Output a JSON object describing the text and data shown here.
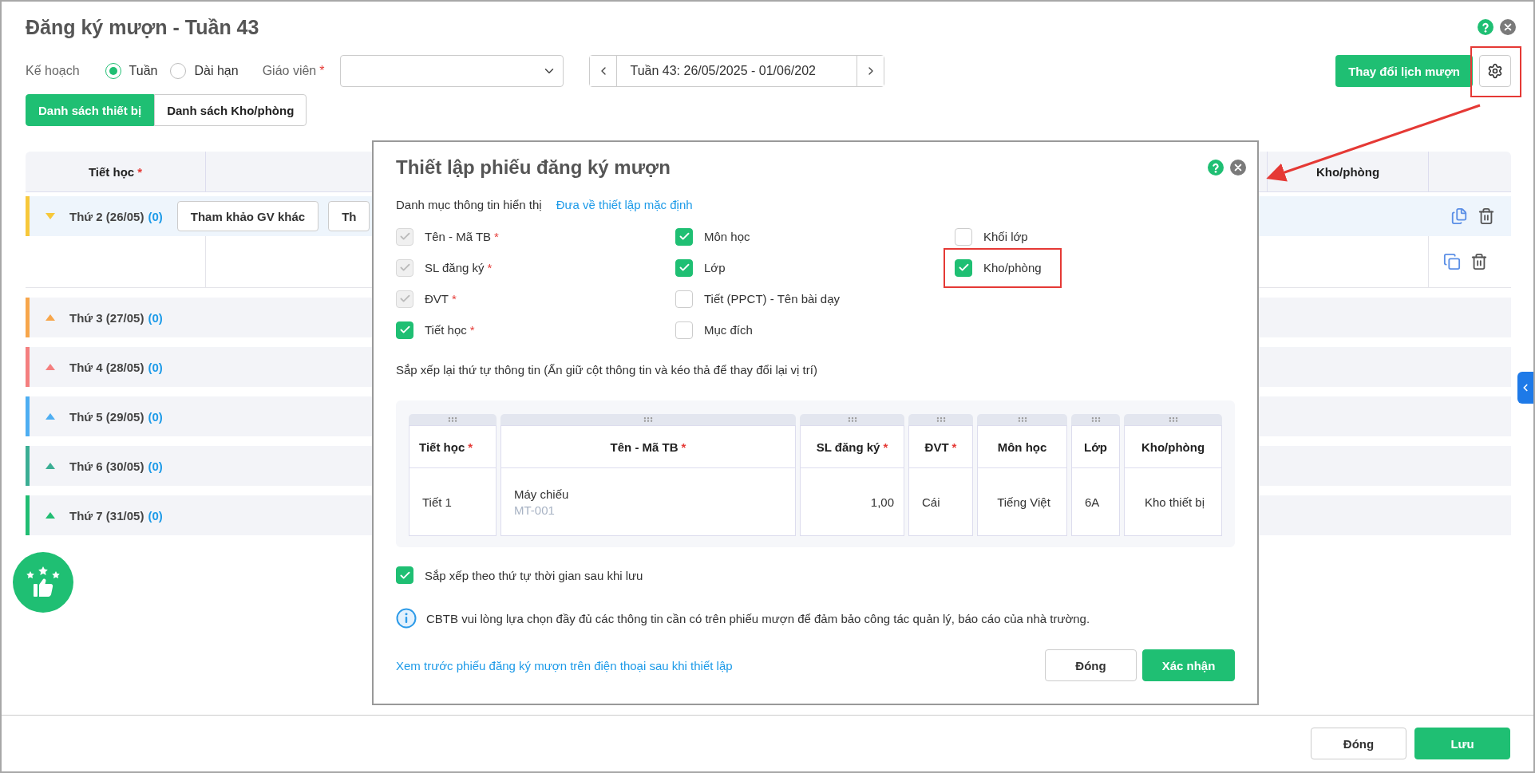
{
  "title": "Đăng ký mượn - Tuần 43",
  "plan": {
    "label": "Kế hoạch",
    "options": [
      {
        "label": "Tuần",
        "selected": true
      },
      {
        "label": "Dài hạn",
        "selected": false
      }
    ]
  },
  "teacher": {
    "label": "Giáo viên",
    "mark": "*"
  },
  "week": {
    "value": "Tuần 43: 26/05/2025 - 01/06/202"
  },
  "change_button": "Thay đổi lịch mượn",
  "tabs": [
    {
      "label": "Danh sách thiết bị",
      "selected": true
    },
    {
      "label": "Danh sách Kho/phòng",
      "selected": false
    }
  ],
  "table": {
    "columns": [
      {
        "label": "Tiết học",
        "mark": "*"
      },
      {
        "label": "Kho/phòng"
      }
    ],
    "days": [
      {
        "label": "Thứ 2 (26/05)",
        "count": "(0)",
        "color": "#f7c83a",
        "expanded": true,
        "buttons": [
          "Tham khảo GV khác",
          "Th"
        ]
      },
      {
        "label": "Thứ 3 (27/05)",
        "count": "(0)",
        "color": "#f7a64b",
        "expanded": false
      },
      {
        "label": "Thứ 4 (28/05)",
        "count": "(0)",
        "color": "#f47f7f",
        "expanded": false
      },
      {
        "label": "Thứ 5 (29/05)",
        "count": "(0)",
        "color": "#4eaef2",
        "expanded": false
      },
      {
        "label": "Thứ 6 (30/05)",
        "count": "(0)",
        "color": "#3bae94",
        "expanded": false
      },
      {
        "label": "Thứ 7 (31/05)",
        "count": "(0)",
        "color": "#21bd72",
        "expanded": false
      }
    ]
  },
  "footer_buttons": [
    {
      "label": "Đóng",
      "kind": "secondary"
    },
    {
      "label": "Lưu",
      "kind": "primary"
    }
  ],
  "dialog": {
    "title": "Thiết lập phiếu đăng ký mượn",
    "section_label": "Danh mục thông tin hiển thị",
    "reset_link": "Đưa về thiết lập mặc định",
    "fields": [
      [
        {
          "label": "Tên - Mã TB",
          "mark": "*",
          "checked": true,
          "disabled": true
        },
        {
          "label": "SL đăng ký",
          "mark": "*",
          "checked": true,
          "disabled": true
        },
        {
          "label": "ĐVT",
          "mark": "*",
          "checked": true,
          "disabled": true
        },
        {
          "label": "Tiết học",
          "mark": "*",
          "checked": true,
          "disabled": false
        }
      ],
      [
        {
          "label": "Môn học",
          "checked": true,
          "disabled": false
        },
        {
          "label": "Lớp",
          "checked": true,
          "disabled": false
        },
        {
          "label": "Tiết (PPCT) - Tên bài dạy",
          "checked": false,
          "disabled": false
        },
        {
          "label": "Mục đích",
          "checked": false,
          "disabled": false
        }
      ],
      [
        {
          "label": "Khối lớp",
          "checked": false,
          "disabled": false
        },
        {
          "label": "Kho/phòng",
          "checked": true,
          "disabled": false,
          "highlighted": true
        }
      ]
    ],
    "order_hint": "Sắp xếp lại thứ tự thông tin (Ấn giữ cột thông tin và kéo thả để thay đổi lại vị trí)",
    "preview": {
      "columns": [
        {
          "label": "Tiết học",
          "mark": "*"
        },
        {
          "label": "Tên - Mã TB",
          "mark": "*"
        },
        {
          "label": "SL đăng ký",
          "mark": "*"
        },
        {
          "label": "ĐVT",
          "mark": "*"
        },
        {
          "label": "Môn học"
        },
        {
          "label": "Lớp"
        },
        {
          "label": "Kho/phòng"
        }
      ],
      "row": [
        "Tiết 1",
        "Máy chiếu",
        "1,00",
        "Cái",
        "Tiếng Việt",
        "6A",
        "Kho thiết bị"
      ],
      "code": "MT-001"
    },
    "sort_option": {
      "label": "Sắp xếp theo thứ tự thời gian sau khi lưu",
      "checked": true
    },
    "info": "CBTB vui lòng lựa chọn đầy đủ các thông tin cần có trên phiếu mượn để đảm bảo công tác quản lý, báo cáo của nhà trường.",
    "preview_link": "Xem trước phiếu đăng ký mượn trên điện thoại sau khi thiết lập",
    "buttons": [
      {
        "label": "Đóng",
        "kind": "secondary"
      },
      {
        "label": "Xác nhận",
        "kind": "primary"
      }
    ]
  }
}
